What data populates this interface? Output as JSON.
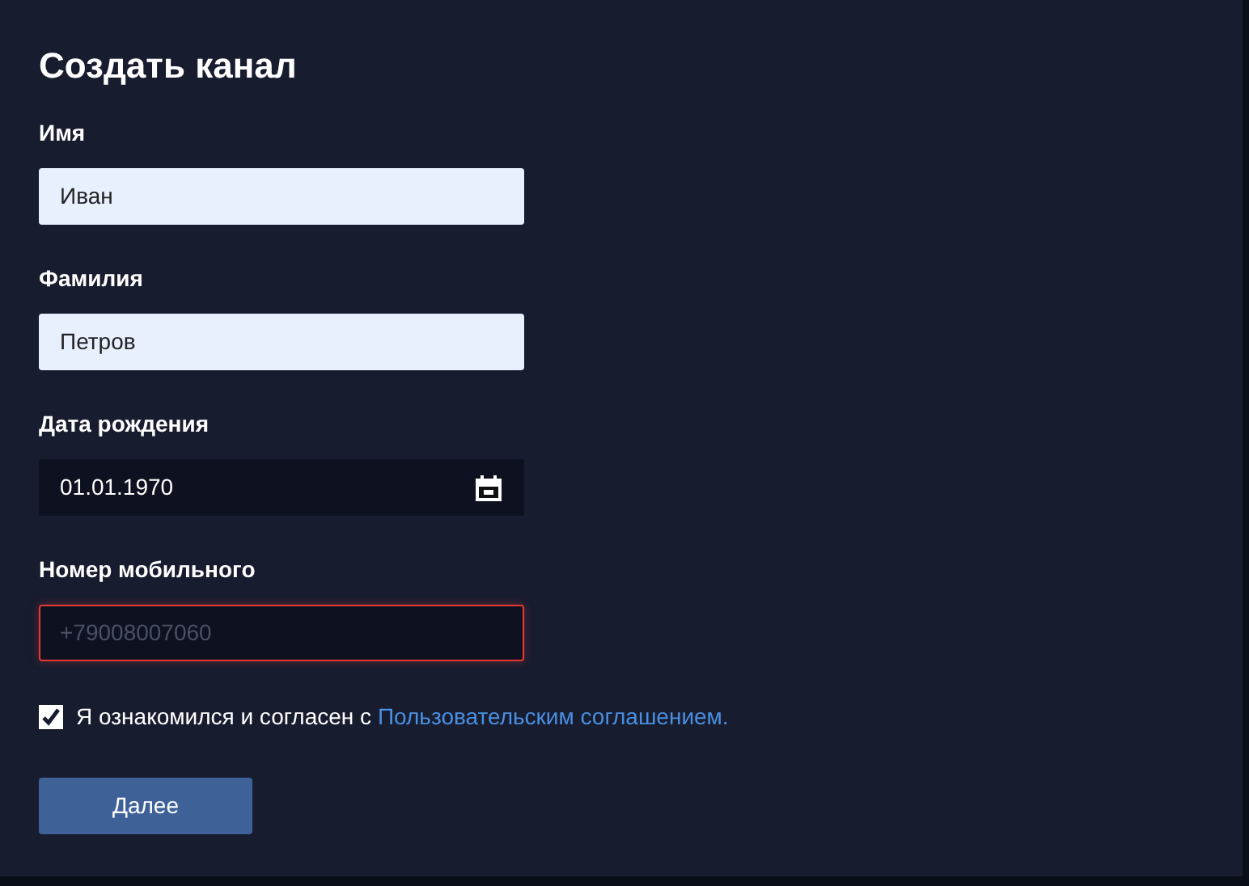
{
  "title": "Создать канал",
  "fields": [
    {
      "kind": "text",
      "label": "Имя",
      "value": "Иван"
    },
    {
      "kind": "text",
      "label": "Фамилия",
      "value": "Петров"
    },
    {
      "kind": "date",
      "label": "Дата рождения",
      "value": "01.01.1970"
    },
    {
      "kind": "phone",
      "label": "Номер мобильного",
      "placeholder": "+79008007060",
      "error": true
    }
  ],
  "agreement": {
    "checked": true,
    "text": "Я ознакомился и согласен с",
    "link": "Пользовательским соглашением."
  },
  "submit": "Далее"
}
